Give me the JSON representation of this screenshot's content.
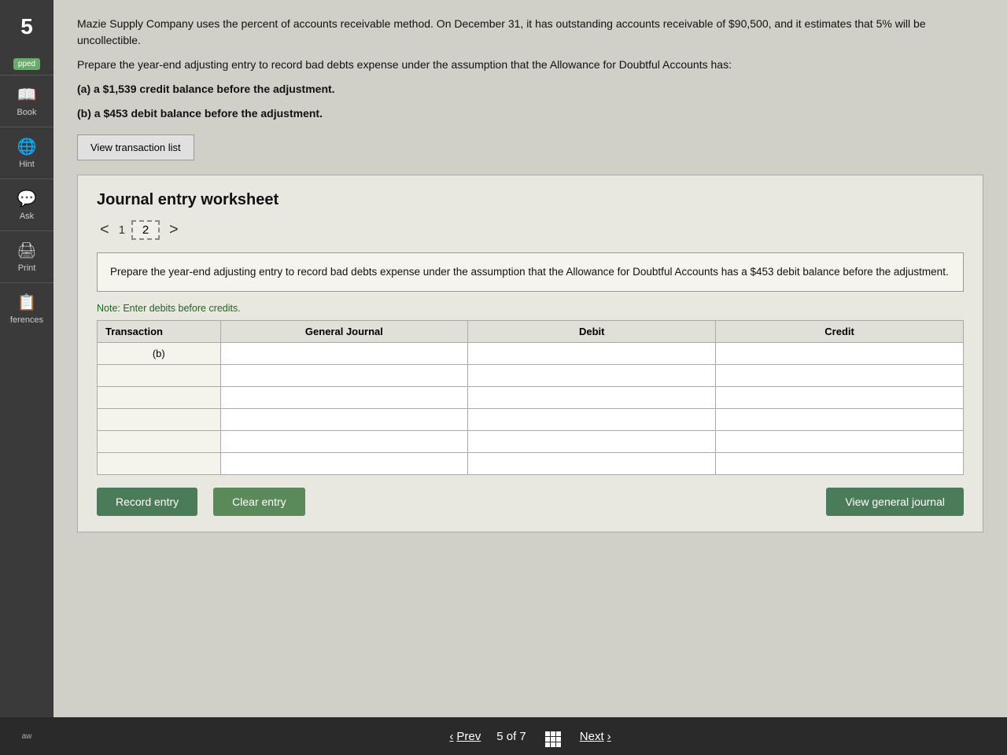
{
  "sidebar": {
    "number": "5",
    "items": [
      {
        "id": "book",
        "icon": "📖",
        "label": "Book"
      },
      {
        "id": "hint",
        "icon": "🌐",
        "label": "Hint"
      },
      {
        "id": "ask",
        "icon": "💬",
        "label": "Ask"
      },
      {
        "id": "print",
        "icon": "🖨",
        "label": "Print"
      },
      {
        "id": "references",
        "icon": "📋",
        "label": "ferences"
      }
    ],
    "badge": "pped"
  },
  "question": {
    "paragraph1": "Mazie Supply Company uses the percent of accounts receivable method. On December 31, it has outstanding accounts receivable of $90,500, and it estimates that 5% will be uncollectible.",
    "paragraph2": "Prepare the year-end adjusting entry to record bad debts expense under the assumption that the Allowance for Doubtful Accounts has:",
    "option_a": "(a) a $1,539 credit balance before the adjustment.",
    "option_b": "(b) a $453 debit balance before the adjustment."
  },
  "view_transaction_btn": "View transaction list",
  "worksheet": {
    "title": "Journal entry worksheet",
    "nav": {
      "prev_label": "1",
      "active_label": "2",
      "chevron_left": "<",
      "chevron_right": ">"
    },
    "instruction": "Prepare the year-end adjusting entry to record bad debts expense under the assumption that the Allowance for Doubtful Accounts has a $453 debit balance before the adjustment.",
    "note": "Note: Enter debits before credits.",
    "table": {
      "headers": [
        "Transaction",
        "General Journal",
        "Debit",
        "Credit"
      ],
      "rows": [
        {
          "transaction": "(b)",
          "journal": "",
          "debit": "",
          "credit": ""
        },
        {
          "transaction": "",
          "journal": "",
          "debit": "",
          "credit": ""
        },
        {
          "transaction": "",
          "journal": "",
          "debit": "",
          "credit": ""
        },
        {
          "transaction": "",
          "journal": "",
          "debit": "",
          "credit": ""
        },
        {
          "transaction": "",
          "journal": "",
          "debit": "",
          "credit": ""
        },
        {
          "transaction": "",
          "journal": "",
          "debit": "",
          "credit": ""
        }
      ]
    }
  },
  "buttons": {
    "record_entry": "Record entry",
    "clear_entry": "Clear entry",
    "view_general_journal": "View general journal"
  },
  "bottom_nav": {
    "prev": "Prev",
    "page_info": "5 of 7",
    "next": "Next"
  },
  "law_bar": {
    "label": "aw"
  }
}
